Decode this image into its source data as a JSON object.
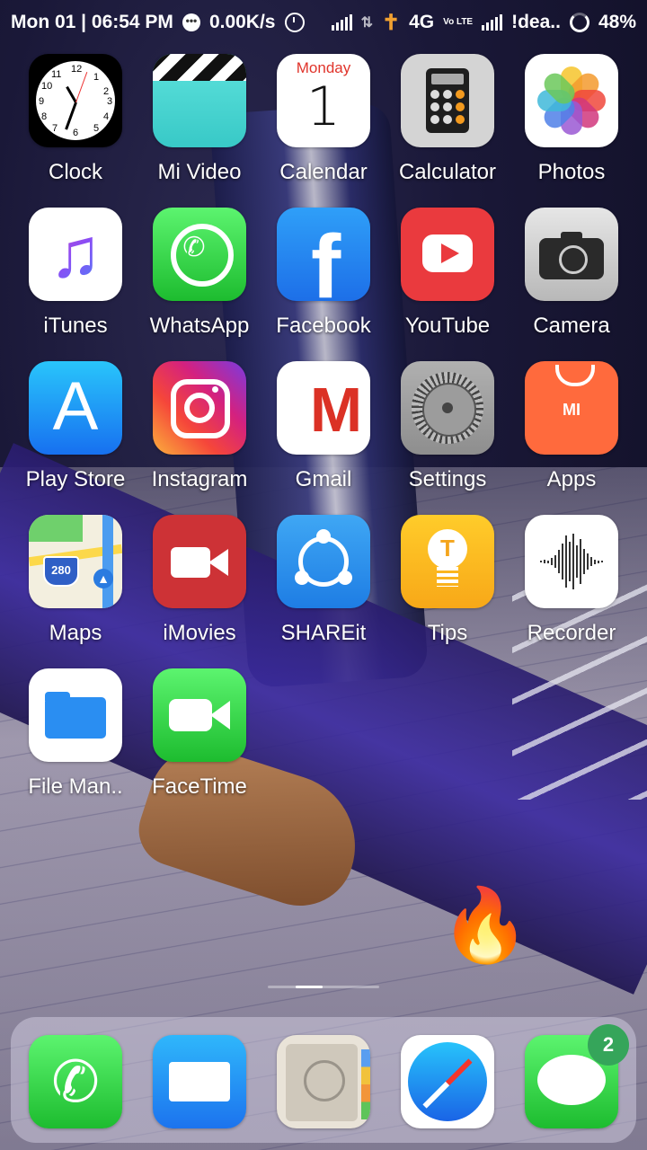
{
  "status_bar": {
    "datetime": "Mon 01 | 06:54 PM",
    "net_speed": "0.00K/s",
    "network_type": "4G",
    "volte": "Vo LTE",
    "carrier": "!dea..",
    "battery": "48%"
  },
  "apps": [
    {
      "label": "Clock",
      "icon": "clock-icon"
    },
    {
      "label": "Mi Video",
      "icon": "clapperboard-icon"
    },
    {
      "label": "Calendar",
      "icon": "calendar-icon",
      "day": "Monday",
      "date": "1"
    },
    {
      "label": "Calculator",
      "icon": "calculator-icon"
    },
    {
      "label": "Photos",
      "icon": "photos-flower-icon"
    },
    {
      "label": "iTunes",
      "icon": "music-note-icon",
      "glyph": "♫"
    },
    {
      "label": "WhatsApp",
      "icon": "whatsapp-icon",
      "glyph": "✆"
    },
    {
      "label": "Facebook",
      "icon": "facebook-icon",
      "glyph": "f"
    },
    {
      "label": "YouTube",
      "icon": "youtube-icon"
    },
    {
      "label": "Camera",
      "icon": "camera-icon"
    },
    {
      "label": "Play Store",
      "icon": "app-store-icon",
      "glyph": "A"
    },
    {
      "label": "Instagram",
      "icon": "instagram-icon"
    },
    {
      "label": "Gmail",
      "icon": "gmail-icon",
      "glyph": "M"
    },
    {
      "label": "Settings",
      "icon": "gear-icon"
    },
    {
      "label": "Apps",
      "icon": "mi-bag-icon",
      "glyph": "MI"
    },
    {
      "label": "Maps",
      "icon": "maps-icon",
      "shield": "280"
    },
    {
      "label": "iMovies",
      "icon": "video-camera-icon"
    },
    {
      "label": "SHAREit",
      "icon": "shareit-icon"
    },
    {
      "label": "Tips",
      "icon": "lightbulb-icon",
      "glyph": "T"
    },
    {
      "label": "Recorder",
      "icon": "waveform-icon"
    },
    {
      "label": "File Man..",
      "icon": "folder-icon"
    },
    {
      "label": "FaceTime",
      "icon": "facetime-icon"
    }
  ],
  "dock": [
    {
      "name": "phone",
      "icon": "phone-icon",
      "glyph": "✆"
    },
    {
      "name": "mail",
      "icon": "mail-icon"
    },
    {
      "name": "contacts",
      "icon": "contacts-icon"
    },
    {
      "name": "safari",
      "icon": "compass-icon"
    },
    {
      "name": "messages",
      "icon": "message-bubble-icon",
      "badge": "2"
    }
  ],
  "colors": {
    "messages_badge": "#35a55a",
    "calendar_day": "#e0342b"
  }
}
